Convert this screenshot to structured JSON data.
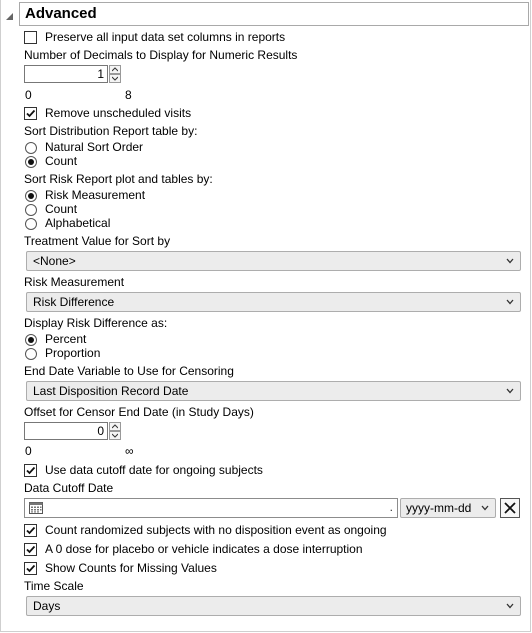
{
  "section": {
    "title": "Advanced"
  },
  "preserve_columns": {
    "label": "Preserve all input data set columns in reports",
    "checked": false
  },
  "decimals": {
    "label": "Number of Decimals to Display for Numeric Results",
    "value": "1",
    "min_label": "0",
    "max_label": "8"
  },
  "remove_unscheduled": {
    "label": "Remove unscheduled visits",
    "checked": true
  },
  "sort_distribution": {
    "label": "Sort Distribution Report table by:",
    "options": [
      {
        "label": "Natural Sort Order",
        "selected": false
      },
      {
        "label": "Count",
        "selected": true
      }
    ]
  },
  "sort_risk": {
    "label": "Sort Risk Report plot and tables by:",
    "options": [
      {
        "label": "Risk Measurement",
        "selected": true
      },
      {
        "label": "Count",
        "selected": false
      },
      {
        "label": "Alphabetical",
        "selected": false
      }
    ]
  },
  "treatment_value": {
    "label": "Treatment Value for Sort by",
    "value": "<None>"
  },
  "risk_measurement": {
    "label": "Risk Measurement",
    "value": "Risk Difference"
  },
  "display_risk": {
    "label": "Display Risk Difference as:",
    "options": [
      {
        "label": "Percent",
        "selected": true
      },
      {
        "label": "Proportion",
        "selected": false
      }
    ]
  },
  "end_date_variable": {
    "label": "End Date Variable to Use for Censoring",
    "value": "Last Disposition Record Date"
  },
  "offset": {
    "label": "Offset for Censor End Date (in Study Days)",
    "value": "0",
    "min_label": "0",
    "max_label": "∞"
  },
  "use_cutoff": {
    "label": "Use data cutoff date for ongoing subjects",
    "checked": true
  },
  "cutoff_date": {
    "label": "Data Cutoff Date",
    "value": "",
    "dot": ".",
    "format": "yyyy-mm-dd"
  },
  "count_randomized": {
    "label": "Count randomized subjects with no disposition event as ongoing",
    "checked": true
  },
  "zero_dose": {
    "label": "A 0 dose for placebo or vehicle indicates a dose interruption",
    "checked": true
  },
  "show_counts_missing": {
    "label": "Show Counts for Missing Values",
    "checked": true
  },
  "time_scale": {
    "label": "Time Scale",
    "value": "Days"
  },
  "icons": {
    "disclosure": "triangle-down-icon",
    "check": "checkmark-icon",
    "dropdown": "chevron-down-icon",
    "calendar": "calendar-icon",
    "clear": "close-icon"
  }
}
